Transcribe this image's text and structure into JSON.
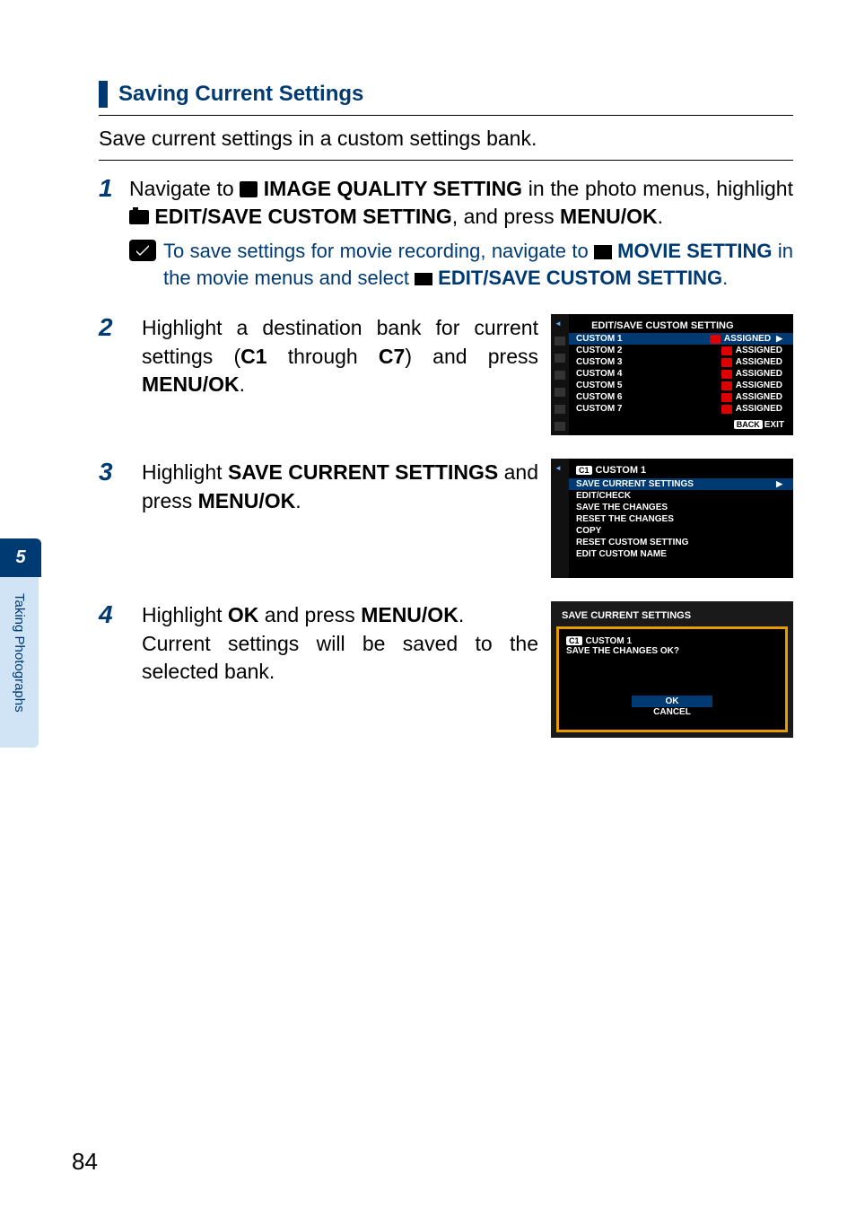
{
  "tab": {
    "chapter": "5",
    "label": "Taking Photographs"
  },
  "page_number": "84",
  "section": {
    "title": "Saving Current Settings",
    "intro": "Save current settings in a custom settings bank."
  },
  "step1": {
    "pre": "Navigate to ",
    "iq_label": " IMAGE QUALITY SETTING",
    "mid1": " in the photo menus, highlight ",
    "cam_label": " EDIT/SAVE CUSTOM SETTING",
    "mid2": ", and press ",
    "menuok": "MENU/OK",
    "end": ".",
    "note_pre": "To save settings for movie recording, navigate to ",
    "note_mov": " MOVIE SETTING",
    "note_mid": " in the movie menus and select ",
    "note_sel": " EDIT/SAVE CUSTOM SETTING",
    "note_end": "."
  },
  "step2": {
    "text_pre": "Highlight a destination bank for current settings (",
    "c1": "C1",
    "mid": " through ",
    "c7": "C7",
    "text_mid": ") and press ",
    "menuok": "MENU/OK",
    "end": "."
  },
  "step3": {
    "pre": "Highlight ",
    "strong": "SAVE CURRENT SETTINGS",
    "mid": " and press ",
    "menuok": "MENU/OK",
    "end": "."
  },
  "step4": {
    "pre": "Highlight ",
    "ok": "OK",
    "mid": " and press ",
    "menuok": "MENU/OK",
    "end": ".",
    "line2": "Current settings will be saved to the selected bank."
  },
  "screen1": {
    "title": "EDIT/SAVE CUSTOM SETTING",
    "items": [
      {
        "name": "CUSTOM 1",
        "tag": "ASSIGNED"
      },
      {
        "name": "CUSTOM 2",
        "tag": "ASSIGNED"
      },
      {
        "name": "CUSTOM 3",
        "tag": "ASSIGNED"
      },
      {
        "name": "CUSTOM 4",
        "tag": "ASSIGNED"
      },
      {
        "name": "CUSTOM 5",
        "tag": "ASSIGNED"
      },
      {
        "name": "CUSTOM 6",
        "tag": "ASSIGNED"
      },
      {
        "name": "CUSTOM 7",
        "tag": "ASSIGNED"
      }
    ],
    "back": "BACK",
    "exit": "EXIT"
  },
  "screen2": {
    "badge": "C1",
    "title": "CUSTOM 1",
    "items": [
      "SAVE CURRENT SETTINGS",
      "EDIT/CHECK",
      "SAVE THE CHANGES",
      "RESET THE CHANGES",
      "COPY",
      "RESET CUSTOM SETTING",
      "EDIT CUSTOM NAME"
    ]
  },
  "screen3": {
    "title": "SAVE CURRENT SETTINGS",
    "badge": "C1",
    "line1": "CUSTOM 1",
    "line2": "SAVE THE CHANGES OK?",
    "ok": "OK",
    "cancel": "CANCEL"
  }
}
